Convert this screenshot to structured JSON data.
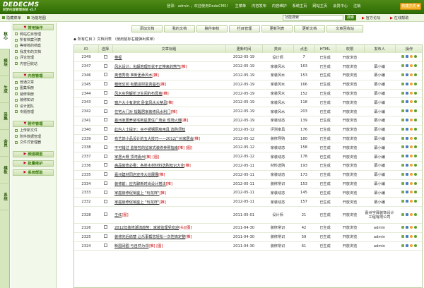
{
  "app": {
    "logo_main": "DEDECMS",
    "logo_sub": "织梦内容管理系统",
    "version": "v5.7"
  },
  "topnav": {
    "welcome": "登录：admin ，欢迎使用DedeCMS!",
    "items": [
      "主菜单",
      "内容发布",
      "内容维护",
      "系统主页",
      "网站主页",
      "会员中心",
      "注销"
    ],
    "quick": "快捷方式 ▼"
  },
  "subbar": {
    "hide_menu": "隐藏菜单",
    "func_map": "功能地图",
    "search_placeholder": "功能搜索",
    "search_button": "搜索",
    "official": "官方论坛",
    "logout": "在线帮助"
  },
  "sidetabs": [
    "核心",
    "模块",
    "生成",
    "采集",
    "会员",
    "模板",
    "系统"
  ],
  "sidemenu": {
    "groups": [
      {
        "title": "常用操作",
        "items": [
          "网站栏目管理",
          "所有档案列表",
          "等审核的档案",
          "我发布的文档",
          "评论管理",
          "内容回收站"
        ]
      },
      {
        "title": "内容管理",
        "items": [
          "普通文章",
          "图集相册",
          "装修相册",
          "装修知识",
          "设计团队",
          "专题管理"
        ]
      },
      {
        "title": "附件管理",
        "items": [
          "上传新文件",
          "附件数据管理",
          "文件式管理器"
        ]
      },
      {
        "title": "频道模型",
        "items": []
      },
      {
        "title": "批量维护",
        "items": []
      },
      {
        "title": "系统帮助",
        "items": []
      }
    ]
  },
  "toolbar": {
    "buttons": [
      "添加文档",
      "我的文档",
      "稿件审核",
      "栏目管理",
      "更新列表",
      "更新文档",
      "文章回收站"
    ]
  },
  "location": {
    "prefix": "◆ 所有栏目 》文档列表",
    "note": "（使用鼠标右键弹出菜单）"
  },
  "table": {
    "headers": [
      "ID",
      "选择",
      "文章标题",
      "更新时间",
      "类目",
      "点击",
      "HTML",
      "权限",
      "发布人",
      "操作"
    ],
    "rows": [
      {
        "id": "2349",
        "title": "带视",
        "tag": "",
        "date": "2012-05-19",
        "cat": "设计师",
        "clicks": "7",
        "html": "已生成",
        "perm": "开放浏览",
        "author": ""
      },
      {
        "id": "2347",
        "title": "风水设计：化解地理形状不正带来的煞气",
        "tag": "[推]",
        "date": "2012-05-19",
        "cat": "家装风水",
        "clicks": "163",
        "html": "已生成",
        "perm": "开放浏览",
        "author": "幕小编"
      },
      {
        "id": "2346",
        "title": "奥普秀物 准新团承风水",
        "tag": "[推]",
        "date": "2012-05-19",
        "cat": "家装风水",
        "clicks": "153",
        "html": "已生成",
        "perm": "开放浏览",
        "author": "幕小编"
      },
      {
        "id": "2345",
        "title": "幡帐空间 有霸进财富贵基石",
        "tag": "[推]",
        "date": "2012-05-19",
        "cat": "家装风水",
        "clicks": "166",
        "html": "已生成",
        "perm": "开放浏览",
        "author": "幕小编"
      },
      {
        "id": "2344",
        "title": "风水实例解析卫生间的布局意",
        "tag": "[推]",
        "date": "2012-05-19",
        "cat": "家装风水",
        "clicks": "152",
        "html": "已生成",
        "perm": "开放浏览",
        "author": "幕小编"
      },
      {
        "id": "2343",
        "title": "窗户大小有讲究 卧室风水大禁忌",
        "tag": "[推]",
        "date": "2012-05-19",
        "cat": "家装风水",
        "clicks": "118",
        "html": "已生成",
        "perm": "开放浏览",
        "author": "幕小编"
      },
      {
        "id": "2342",
        "title": "住宅大门对 提醒居家装修风水利门",
        "tag": "[推]",
        "date": "2012-05-19",
        "cat": "家装风水",
        "clicks": "203",
        "html": "已生成",
        "perm": "开放浏览",
        "author": "幕小编"
      },
      {
        "id": "2341",
        "title": "嘉州家居养装宅新星居住广场会 现场火爆",
        "tag": "[推]",
        "date": "2012-05-19",
        "cat": "家装动态",
        "clicks": "139",
        "html": "已生成",
        "perm": "开放浏览",
        "author": "幕小编"
      },
      {
        "id": "2340",
        "title": "此内人士提示：买不锈钢厨房用具 选购须知",
        "tag": "",
        "date": "2012-05-12",
        "cat": "评测家具",
        "clicks": "176",
        "html": "已生成",
        "perm": "开放浏览",
        "author": "幕小编"
      },
      {
        "id": "2339",
        "title": "布艺饰小品设计的五大技巧——2012广州家居会",
        "tag": "[推]",
        "date": "2012-05-12",
        "cat": "装修导购",
        "clicks": "180",
        "html": "已生成",
        "perm": "开放浏览",
        "author": "幕小编"
      },
      {
        "id": "2338",
        "title": "不可错过 监管控的监家式装修参照指南",
        "tag": "[推] [图]",
        "date": "2012-05-12",
        "cat": "家装动态",
        "clicks": "158",
        "html": "已生成",
        "perm": "开放浏览",
        "author": "幕小编"
      },
      {
        "id": "2337",
        "title": "家居大概 顶湾嘉州",
        "tag": "[推] [图]",
        "date": "2012-05-12",
        "cat": "家装动态",
        "clicks": "178",
        "html": "已生成",
        "perm": "开放浏览",
        "author": "幕小编"
      },
      {
        "id": "2336",
        "title": "高品装修必看：各类木材材料选购知识大全",
        "tag": "[推]",
        "date": "2012-05-11",
        "cat": "材料选购",
        "clicks": "193",
        "html": "已生成",
        "perm": "开放浏览",
        "author": "幕小编"
      },
      {
        "id": "2335",
        "title": "嘉州建材同店宣传大巡展展",
        "tag": "[推]",
        "date": "2012-05-11",
        "cat": "家装动态",
        "clicks": "173",
        "html": "已生成",
        "perm": "开放浏览",
        "author": "幕小编"
      },
      {
        "id": "2334",
        "title": "装修前：应先聊新时尚设计搭法",
        "tag": "[推]",
        "date": "2012-05-11",
        "cat": "装修常识",
        "clicks": "153",
        "html": "已生成",
        "perm": "开放浏览",
        "author": "幕小编"
      },
      {
        "id": "2333",
        "title": "家庭装修促销鉴上 \"玩花样\"",
        "tag": "[推]",
        "date": "2012-05-11",
        "cat": "家装动态",
        "clicks": "145",
        "html": "已生成",
        "perm": "开放浏览",
        "author": "幕小编"
      },
      {
        "id": "2332",
        "title": "家庭装修促销鉴上 \"玩花样\"",
        "tag": "[推]",
        "date": "2012-05-11",
        "cat": "家装动态",
        "clicks": "157",
        "html": "已生成",
        "perm": "开放浏览",
        "author": "幕小编"
      },
      {
        "id": "2328",
        "title": "王红",
        "tag": "[图]",
        "date": "2011-05-01",
        "cat": "设计师",
        "clicks": "21",
        "html": "已生成",
        "perm": "开放浏览",
        "author": "嘉州宇驿装饰设计工程有限公司"
      },
      {
        "id": "2326",
        "title": "2012年装修潮流趋势：家装监理受欢迎",
        "tag": "[头][图]",
        "date": "2011-04-30",
        "cat": "装修常识",
        "clicks": "42",
        "html": "已生成",
        "perm": "开放浏览",
        "author": "admin"
      },
      {
        "id": "2325",
        "title": "装修完后偷替 让乐事帮您轻松一次性搞定整",
        "tag": "[推]",
        "date": "2011-04-30",
        "cat": "装修常识",
        "clicks": "59",
        "html": "已生成",
        "perm": "开放浏览",
        "author": "admin"
      },
      {
        "id": "2324",
        "title": "新国阔圈 与自然为邻",
        "tag": "[推] [图]",
        "date": "2011-04-30",
        "cat": "装修常识",
        "clicks": "61",
        "html": "已生成",
        "perm": "开放浏览",
        "author": "admin"
      }
    ]
  }
}
